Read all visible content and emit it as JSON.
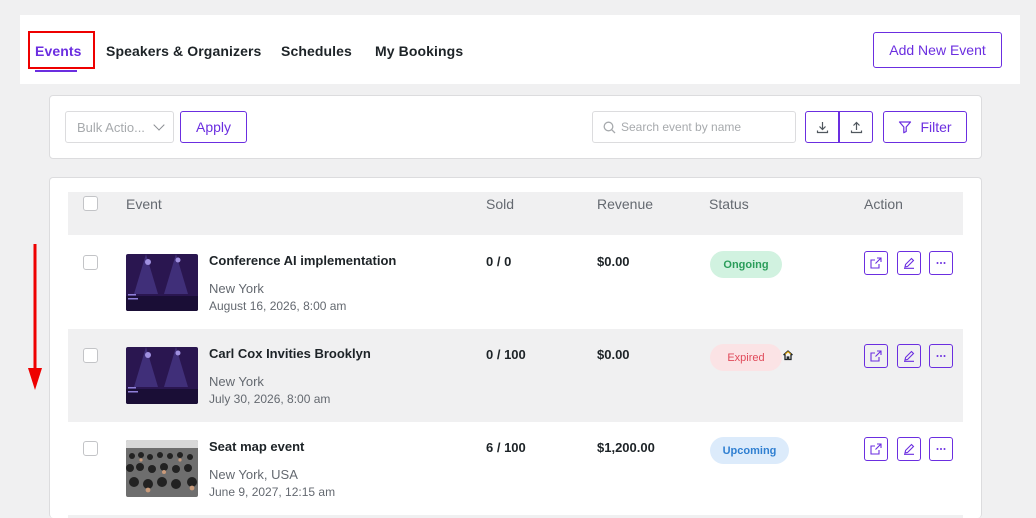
{
  "tabs": [
    {
      "label": "Events",
      "active": true
    },
    {
      "label": "Speakers & Organizers"
    },
    {
      "label": "Schedules"
    },
    {
      "label": "My Bookings"
    }
  ],
  "add_new_event": "Add New Event",
  "toolbar": {
    "bulk_placeholder": "Bulk Actio...",
    "apply": "Apply",
    "search_placeholder": "Search event by name",
    "filter": "Filter"
  },
  "table": {
    "headers": {
      "event": "Event",
      "sold": "Sold",
      "revenue": "Revenue",
      "status": "Status",
      "action": "Action"
    },
    "rows": [
      {
        "name": "Conference AI implementation",
        "location": "New York",
        "date": "August 16, 2026, 8:00 am",
        "sold": "0 / 0",
        "revenue": "$0.00",
        "status": "Ongoing"
      },
      {
        "name": "Carl Cox Invities Brooklyn",
        "location": "New York",
        "date": "July 30, 2026, 8:00 am",
        "sold": "0 / 100",
        "revenue": "$0.00",
        "status": "Expired"
      },
      {
        "name": "Seat map event",
        "location": "New York, USA",
        "date": "June 9, 2027, 12:15 am",
        "sold": "6 / 100",
        "revenue": "$1,200.00",
        "status": "Upcoming"
      }
    ]
  },
  "colors": {
    "accent": "#6b2ee0",
    "annotation": "#e00000"
  }
}
